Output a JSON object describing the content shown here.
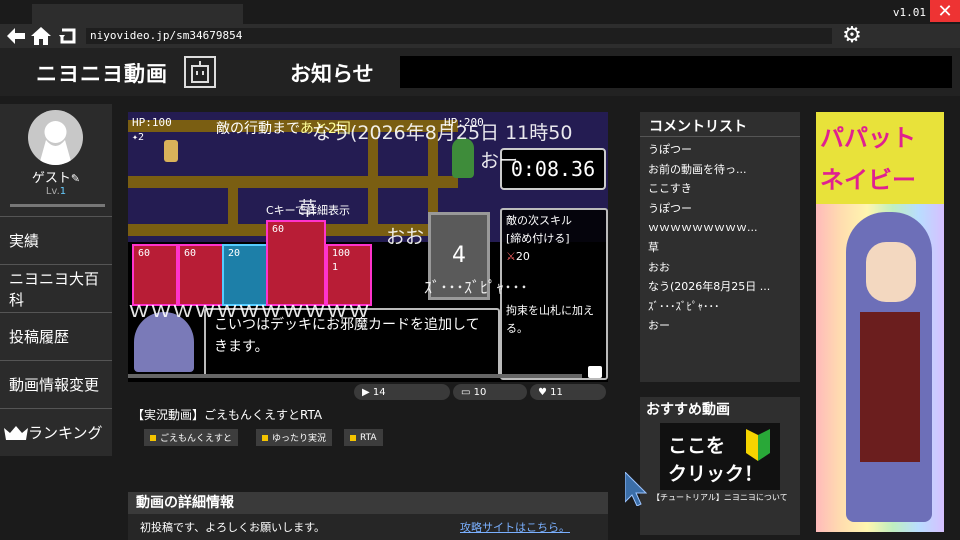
{
  "browser": {
    "version": "v1.01",
    "close": "✕",
    "url": "niyovideo.jp/sm34679854"
  },
  "header": {
    "site_title": "ニヨニヨ動画",
    "news_label": "お知らせ"
  },
  "sidebar": {
    "user_name": "ゲスト",
    "user_level_prefix": "Lv.",
    "user_level": "1",
    "items": [
      {
        "label": "実績"
      },
      {
        "label": "ニヨニヨ大百科"
      },
      {
        "label": "投稿履歴"
      },
      {
        "label": "動画情報変更"
      },
      {
        "label": "ランキング"
      }
    ]
  },
  "game": {
    "player_hp": "HP:100",
    "enemy_hp": "HP:200",
    "player_stat": "2",
    "enemy_turn_text": "敵の行動まで",
    "enemy_turn_count": "あと2回",
    "timer": "0:08.36",
    "c_key_hint": "Cキーで詳細表示",
    "deck_count": "4",
    "cards": [
      {
        "value": "60"
      },
      {
        "value": "60"
      },
      {
        "value": "20"
      },
      {
        "value": "60"
      },
      {
        "value": "100"
      }
    ],
    "card_sub": "1",
    "dialogue": "こいつはデッキにお邪魔カードを追加してきます。",
    "skill_title": "敵の次スキル",
    "skill_name": "[締め付ける]",
    "skill_value": "20",
    "skill_desc": "拘束を山札に加える。",
    "danmaku": [
      {
        "text": "なう(2026年8月25日 11時50"
      },
      {
        "text": "おー"
      },
      {
        "text": "草"
      },
      {
        "text": "おお"
      },
      {
        "text": "ｽﾞ･･･ｽﾞﾋﾟｬ･･･"
      },
      {
        "text": "ｗｗｗｗｗｗｗｗｗｗｗ"
      }
    ]
  },
  "stats": {
    "plays": "14",
    "comments": "10",
    "likes": "11"
  },
  "video": {
    "title": "【実況動画】ごえもんくえすとRTA",
    "tags": [
      {
        "label": "ごえもんくえすと"
      },
      {
        "label": "ゆったり実況"
      },
      {
        "label": "RTA"
      }
    ]
  },
  "detail": {
    "header": "動画の詳細情報",
    "text": "初投稿です、よろしくお願いします。",
    "link": "攻略サイトはこちら。"
  },
  "comments": {
    "header": "コメントリスト",
    "items": [
      {
        "text": "うぽつー"
      },
      {
        "text": "お前の動画を待っ..."
      },
      {
        "text": "ここすき"
      },
      {
        "text": "うぽつー"
      },
      {
        "text": "ｗｗｗｗｗｗｗｗｗ..."
      },
      {
        "text": "草"
      },
      {
        "text": "おお"
      },
      {
        "text": "なう(2026年8月25日 ..."
      },
      {
        "text": "ｽﾞ･･･ｽﾞﾋﾟｬ･･･"
      },
      {
        "text": "おー"
      }
    ]
  },
  "recommend": {
    "header": "おすすめ動画",
    "thumb_line1": "ここを",
    "thumb_line2": "クリック！",
    "caption": "【チュートリアル】ニヨニヨについて"
  },
  "ad": {
    "line1": "パパット",
    "line2": "ネイビー"
  },
  "colors": {
    "accent_red": "#b81d36",
    "tag_yellow": "#f5c400",
    "link_blue": "#7ab0ff",
    "level_blue": "#66ccff",
    "close_red": "#e33333"
  }
}
